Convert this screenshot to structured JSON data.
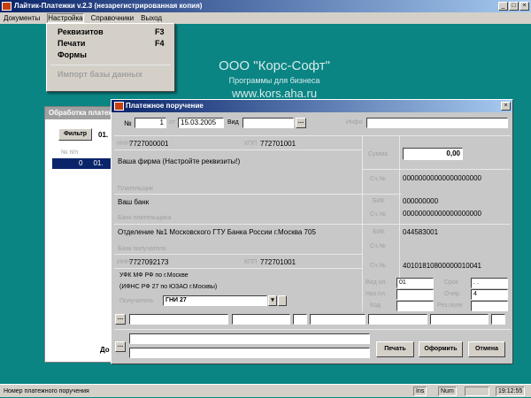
{
  "app": {
    "title": "Лайтик-Платежки v.2.3 (незарегистрированная копия)"
  },
  "menu": [
    "Документы",
    "Настройка",
    "Справочники",
    "Выход"
  ],
  "dropdown": [
    {
      "label": "Реквизитов",
      "key": "F3"
    },
    {
      "label": "Печати",
      "key": "F4"
    },
    {
      "label": "Формы",
      "key": ""
    },
    {
      "label": "Импорт базы данных",
      "key": ""
    }
  ],
  "logo": {
    "name": "ООО \"Корс-Софт\"",
    "tagline": "Программы для бизнеса",
    "url": "www.kors.aha.ru"
  },
  "back_window": {
    "title": "Обработка платежей",
    "filter": "Фильтр",
    "date": "01.",
    "col": "№ п/п",
    "row_no": "0",
    "row_date": "01.",
    "footer": "До"
  },
  "dialog": {
    "title": "Платежное поручение",
    "no_label": "№",
    "no": "1",
    "from_label": "от",
    "date": "15.03.2005",
    "kind_label": "Вид",
    "kind": "",
    "info_label": "Инфо",
    "info": "",
    "payer_inn_label": "ИНН",
    "payer_inn": "7727000001",
    "payer_kpp_label": "КПП",
    "payer_kpp": "772701001",
    "payer_name": "Ваша фирма (Настройте реквизиты!)",
    "payer_label": "Плательщик",
    "payer_bank": "Ваш банк",
    "payer_bank_label": "Банк плательщика",
    "rcpt_bank": "Отделение №1 Московского ГТУ Банка России г.Москва 705",
    "rcpt_bank_label": "Банк получателя",
    "rcpt_inn": "7727092173",
    "rcpt_kpp": "772701001",
    "rcpt_name1": "УФК МФ РФ по г.Москве",
    "rcpt_name2": "(ИФНС РФ 27 по ЮЗАО г.Москвы)",
    "rcpt_label": "Получатель",
    "rcpt_combo": "ГНИ 27",
    "sum_label": "Сумма",
    "sum": "0,00",
    "acc_label": "Сч.№",
    "bik_label": "БИК",
    "payer_acc": "00000000000000000000",
    "payer_bik": "000000000",
    "payer_corr": "00000000000000000000",
    "rcpt_bik": "044583001",
    "rcpt_corr": "",
    "rcpt_acc": "40101810800000010041",
    "op_label": "Вид оп.",
    "op": "01",
    "purpose_label": "Наз.пл.",
    "code_label": "Код",
    "term_label": "Срок",
    "term": ". .",
    "order_label": "Очер.",
    "order": "4",
    "res_label": "Рез.поле",
    "print": "Печать",
    "issue": "Оформить",
    "cancel": "Отмена"
  },
  "status": {
    "text": "Номер платежного поручения",
    "ins": "Ins",
    "num": "Num",
    "time": "19:12:55"
  }
}
